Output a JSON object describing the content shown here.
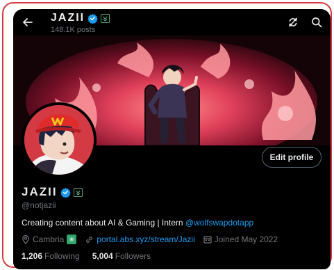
{
  "header": {
    "title": "JAZII",
    "posts_count": "148.1K posts"
  },
  "profile": {
    "display_name": "JAZII",
    "handle": "@notjazii",
    "edit_button": "Edit profile",
    "bio_text": "Creating content about AI & Gaming | Intern ",
    "bio_mention": "@wolfswapdotapp",
    "location": "Cambria",
    "location_emoji": "✳",
    "website": "portal.abs.xyz/stream/Jazii",
    "joined": "Joined May 2022",
    "following_count": "1,206",
    "following_label": "Following",
    "followers_count": "5,004",
    "followers_label": "Followers"
  },
  "colors": {
    "accent": "#1d9bf0",
    "frame_border": "#d9393e",
    "muted_text": "#71767b"
  },
  "icons": [
    "back-arrow-icon",
    "verified-badge-icon",
    "affiliate-badge-icon",
    "refresh-icon",
    "search-icon",
    "location-icon",
    "link-icon",
    "calendar-icon"
  ]
}
